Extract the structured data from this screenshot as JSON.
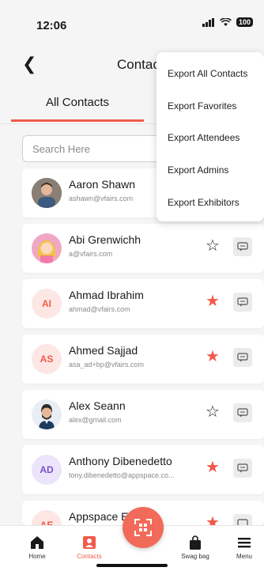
{
  "status": {
    "time": "12:06",
    "battery": "100"
  },
  "header": {
    "title": "Contac"
  },
  "tabs": {
    "all_contacts": "All Contacts"
  },
  "search": {
    "placeholder": "Search Here"
  },
  "colors": {
    "accent": "#f15a4a",
    "initials_bg": "#fde7e5",
    "initials_bg_alt": "#ebe4fa",
    "initials_text_alt": "#7a52c7"
  },
  "contacts": [
    {
      "name": "Aaron Shawn",
      "email": "ashawn@vfairs.com",
      "avatar": "photo",
      "initials": "",
      "favorite": null
    },
    {
      "name": "Abi Grenwichh",
      "email": "a@vfairs.com",
      "avatar": "illustration-woman",
      "initials": "",
      "favorite": false
    },
    {
      "name": "Ahmad Ibrahim",
      "email": "ahmad@vfairs.com",
      "avatar": "initials",
      "initials": "AI",
      "favorite": true
    },
    {
      "name": "Ahmed  Sajjad",
      "email": "asa_ad+bp@vfairs.com",
      "avatar": "initials",
      "initials": "AS",
      "favorite": true
    },
    {
      "name": "Alex Seann",
      "email": "alex@gmail.com",
      "avatar": "illustration-man",
      "initials": "",
      "favorite": false
    },
    {
      "name": "Anthony Dibenedetto",
      "email": "tony.dibenedetto@appspace.co...",
      "avatar": "initials",
      "initials": "AD",
      "favorite": true
    },
    {
      "name": "Appspace E",
      "email": "",
      "avatar": "initials",
      "initials": "AE",
      "favorite": true
    }
  ],
  "menu": {
    "export_all": "Export All Contacts",
    "export_favorites": "Export Favorites",
    "export_attendees": "Export Attendees",
    "export_admins": "Export Admins",
    "export_exhibitors": "Export Exhibitors"
  },
  "nav": {
    "home": "Home",
    "contacts": "Contacts",
    "swag_bag": "Swag bag",
    "menu": "Menu"
  },
  "icons": [
    "back-icon",
    "signal-icon",
    "wifi-icon",
    "star-icon",
    "chat-icon",
    "qr-scan-icon",
    "home-icon",
    "contacts-icon",
    "bag-icon",
    "menu-icon"
  ]
}
